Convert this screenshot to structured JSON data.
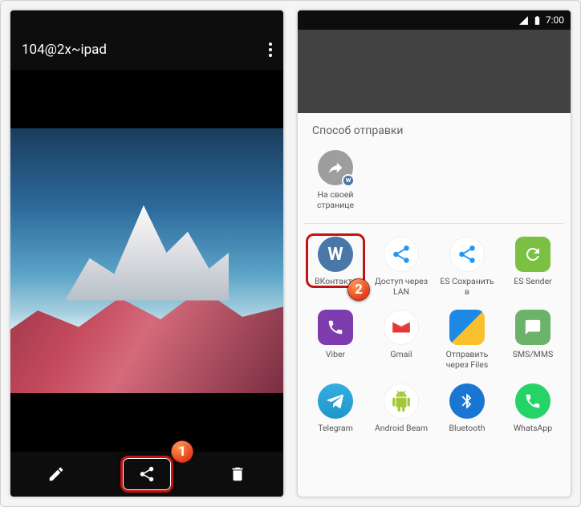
{
  "left": {
    "title": "104@2x~ipad"
  },
  "right": {
    "status_time": "7:00",
    "sheet_title": "Способ отправки",
    "featured": {
      "label": "На своей странице"
    },
    "apps": [
      {
        "label": "ВКонтакте"
      },
      {
        "label": "Доступ через LAN"
      },
      {
        "label": "ES Сохранить в"
      },
      {
        "label": "ES Sender"
      },
      {
        "label": "Viber"
      },
      {
        "label": "Gmail"
      },
      {
        "label": "Отправить через Files"
      },
      {
        "label": "SMS/MMS"
      },
      {
        "label": "Telegram"
      },
      {
        "label": "Android Beam"
      },
      {
        "label": "Bluetooth"
      },
      {
        "label": "WhatsApp"
      }
    ]
  },
  "callouts": {
    "step1": "1",
    "step2": "2"
  }
}
